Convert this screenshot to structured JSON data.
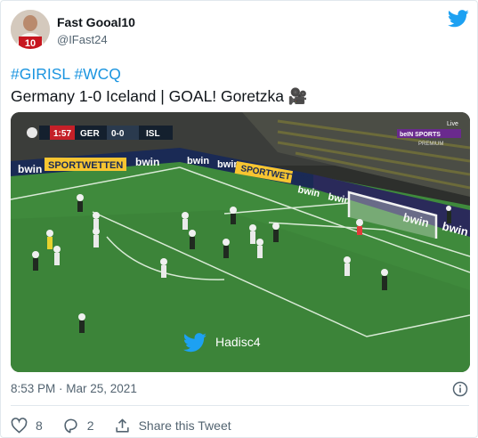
{
  "tweet": {
    "display_name": "Fast Gooal10",
    "handle": "@IFast24",
    "avatar_text": "10",
    "hashtags": [
      "#GIRISL",
      "#WCQ"
    ],
    "text_line2": "Germany 1-0 Iceland | GOAL! Goretzka 🎥",
    "timestamp": "8:53 PM · Mar 25, 2021",
    "likes": "8",
    "replies": "2",
    "share_label": "Share this Tweet"
  },
  "video": {
    "clock": "1:57",
    "home_team": "GER",
    "score": "0-0",
    "away_team": "ISL",
    "ad_texts": [
      "bwin",
      "SPORTWETTEN",
      "bwin",
      "bwin",
      "bwin",
      "SPORTWETTEN",
      "bwin",
      "bwin",
      "bwin",
      "bwin"
    ],
    "watermark": "Hadisc4",
    "broadcaster": "beIN SPORTS",
    "premium": "PREMIUM",
    "live": "Live"
  },
  "colors": {
    "accent": "#1b95e0",
    "twitter_blue": "#1da1f2",
    "pitch": "#3b7d3a",
    "text_secondary": "#536471"
  },
  "icons": [
    "twitter-bird-icon",
    "info-icon",
    "heart-icon",
    "reply-icon",
    "share-icon",
    "video-camera-emoji"
  ]
}
